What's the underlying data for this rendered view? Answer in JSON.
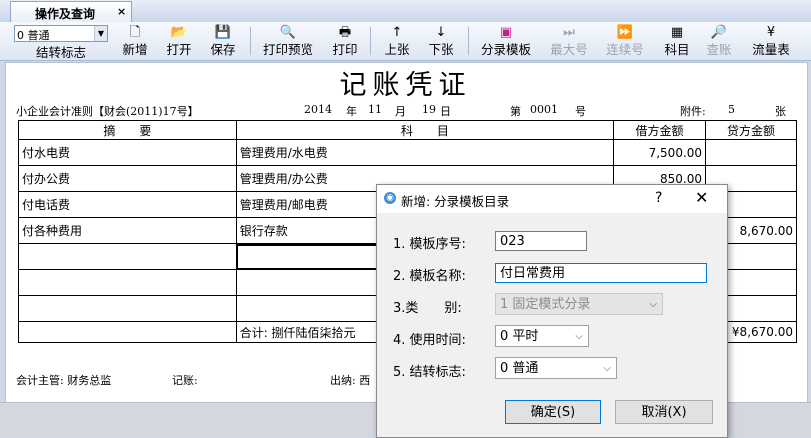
{
  "tab": {
    "label": "操作及查询",
    "close": "×"
  },
  "toolbar": {
    "combo_value": "0 普通",
    "combo_label": "结转标志",
    "buttons": [
      {
        "label": "新增",
        "icon": "🗋"
      },
      {
        "label": "打开",
        "icon": "📂"
      },
      {
        "label": "保存",
        "icon": "💾"
      },
      {
        "label": "打印预览",
        "icon": "🔍"
      },
      {
        "label": "打印",
        "icon": "🖶"
      },
      {
        "label": "上张",
        "icon": "↑"
      },
      {
        "label": "下张",
        "icon": "↓"
      },
      {
        "label": "分录模板",
        "icon": "▣"
      },
      {
        "label": "最大号",
        "icon": "⏭"
      },
      {
        "label": "连续号",
        "icon": "⏩"
      },
      {
        "label": "科目",
        "icon": "▦"
      },
      {
        "label": "查账",
        "icon": "🔎"
      },
      {
        "label": "流量表",
        "icon": "¥"
      }
    ]
  },
  "voucher": {
    "title": "记账凭证",
    "standard": "小企业会计准则【财会(2011)17号】",
    "year": "2014",
    "year_unit": "年",
    "month": "11",
    "month_unit": "月",
    "day": "19",
    "day_unit": "日",
    "no_label": "第",
    "no": "0001",
    "no_unit": "号",
    "attach_label": "附件:",
    "attach": "5",
    "attach_unit": "张",
    "headers": {
      "summary": "摘　　要",
      "account": "科　　目",
      "debit": "借方金额",
      "credit": "贷方金额"
    },
    "rows": [
      {
        "summary": "付水电费",
        "account": "管理费用/水电费",
        "debit": "7,500.00",
        "credit": ""
      },
      {
        "summary": "付办公费",
        "account": "管理费用/办公费",
        "debit": "850.00",
        "credit": ""
      },
      {
        "summary": "付电话费",
        "account": "管理费用/邮电费",
        "debit": "",
        "credit": ""
      },
      {
        "summary": "付各种费用",
        "account": "银行存款",
        "debit": "",
        "credit": "8,670.00"
      },
      {
        "summary": "",
        "account": "",
        "debit": "",
        "credit": ""
      },
      {
        "summary": "",
        "account": "",
        "debit": "",
        "credit": ""
      },
      {
        "summary": "",
        "account": "",
        "debit": "",
        "credit": ""
      },
      {
        "summary": "",
        "account": "",
        "debit": "",
        "credit": ""
      }
    ],
    "total_label": "合计: 捌仟陆佰柒拾元",
    "total_credit": "¥8,670.00",
    "footer": {
      "supervisor": "会计主管: 财务总监",
      "bookkeeper": "记账:",
      "cashier": "出纳: 西"
    }
  },
  "dialog": {
    "title": "新增: 分录模板目录",
    "help": "?",
    "close": "✕",
    "fields": {
      "seq_label": "1. 模板序号:",
      "seq_value": "023",
      "name_label": "2. 模板名称:",
      "name_value": "付日常费用",
      "type_label": "3.类　　别:",
      "type_value": "1 固定模式分录",
      "time_label": "4. 使用时间:",
      "time_value": "0 平时",
      "flag_label": "5. 结转标志:",
      "flag_value": "0 普通"
    },
    "ok": "确定(S)",
    "cancel": "取消(X)"
  }
}
